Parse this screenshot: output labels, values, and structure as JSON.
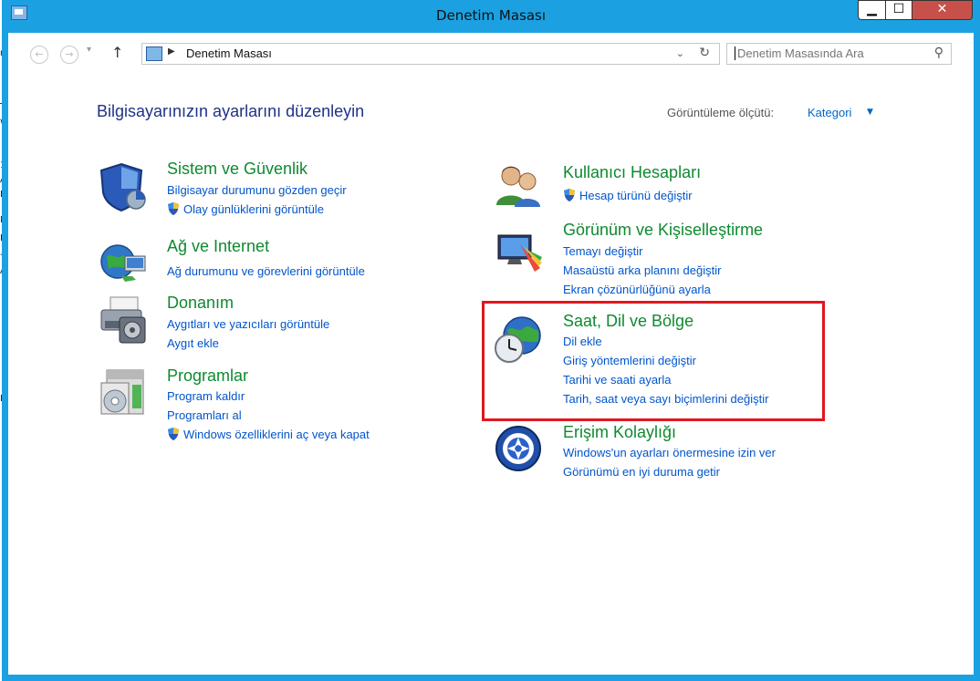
{
  "window": {
    "title": "Denetim Masası",
    "buttons": {
      "minimize": "▁",
      "maximize": "☐",
      "close": "✕"
    }
  },
  "background_fragments": [
    "n",
    "T",
    "w",
    "1",
    "A",
    "H",
    "M",
    "E",
    "-",
    "A",
    "Bi"
  ],
  "nav": {
    "back_icon": "arrow-left-icon",
    "forward_icon": "arrow-right-icon",
    "up_icon": "arrow-up-icon",
    "breadcrumb": "Denetim Masası",
    "search_placeholder": "Denetim Masasında Ara"
  },
  "page": {
    "heading": "Bilgisayarınızın ayarlarını düzenleyin",
    "view_by_label": "Görüntüleme ölçütü:",
    "view_by_value": "Kategori"
  },
  "categories": [
    {
      "title": "Sistem ve Güvenlik",
      "icon": "shield-icon",
      "links": [
        {
          "text": "Bilgisayar durumunu gözden geçir",
          "shield": false
        },
        {
          "text": "Olay günlüklerini görüntüle",
          "shield": true
        }
      ]
    },
    {
      "title": "Ağ ve Internet",
      "icon": "network-globe-icon",
      "links": [
        {
          "text": "Ağ durumunu ve görevlerini görüntüle",
          "shield": false
        }
      ]
    },
    {
      "title": "Donanım",
      "icon": "printer-icon",
      "links": [
        {
          "text": "Aygıtları ve yazıcıları görüntüle",
          "shield": false
        },
        {
          "text": "Aygıt ekle",
          "shield": false
        }
      ]
    },
    {
      "title": "Programlar",
      "icon": "programs-icon",
      "links": [
        {
          "text": "Program kaldır",
          "shield": false
        },
        {
          "text": "Programları al",
          "shield": false
        },
        {
          "text": "Windows özelliklerini aç veya kapat",
          "shield": true
        }
      ]
    },
    {
      "title": "Kullanıcı Hesapları",
      "icon": "users-icon",
      "links": [
        {
          "text": "Hesap türünü değiştir",
          "shield": true
        }
      ]
    },
    {
      "title": "Görünüm ve Kişiselleştirme",
      "icon": "personalization-icon",
      "links": [
        {
          "text": "Temayı değiştir",
          "shield": false
        },
        {
          "text": "Masaüstü arka planını değiştir",
          "shield": false
        },
        {
          "text": "Ekran çözünürlüğünü ayarla",
          "shield": false
        }
      ]
    },
    {
      "title": "Saat, Dil ve Bölge",
      "icon": "globe-clock-icon",
      "links": [
        {
          "text": "Dil ekle",
          "shield": false
        },
        {
          "text": "Giriş yöntemlerini değiştir",
          "shield": false
        },
        {
          "text": "Tarihi ve saati ayarla",
          "shield": false
        },
        {
          "text": "Tarih, saat veya sayı biçimlerini değiştir",
          "shield": false
        }
      ]
    },
    {
      "title": "Erişim Kolaylığı",
      "icon": "accessibility-icon",
      "links": [
        {
          "text": "Windows'un ayarları önermesine izin ver",
          "shield": false
        },
        {
          "text": "Görünümü en iyi duruma getir",
          "shield": false
        }
      ]
    }
  ],
  "colors": {
    "titlebar": "#1ba1e2",
    "category_title": "#0e8a2f",
    "link": "#0055cc",
    "heading": "#1e3287",
    "highlight": "#e0161e"
  }
}
